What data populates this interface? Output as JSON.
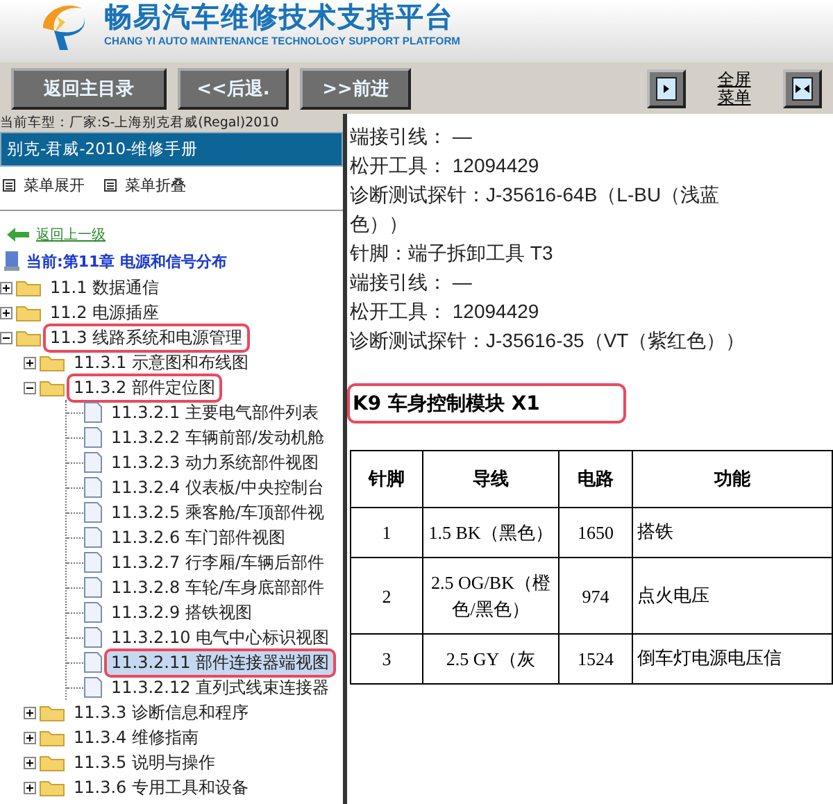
{
  "header": {
    "title": "畅易汽车维修技术支持平台",
    "subtitle": "CHANG YI AUTO MAINTENANCE TECHNOLOGY SUPPORT PLATFORM"
  },
  "toolbar": {
    "buttons": [
      "返回主目录",
      "<<后退.",
      ">>前进"
    ],
    "fullscreen_label": "全屏菜单"
  },
  "sidebar": {
    "vehicle": "当前车型：厂家:S-上海别克君威(Regal)2010",
    "manual_title": "别克-君威-2010-维修手册",
    "menu_actions": [
      "菜单展开",
      "菜单折叠"
    ],
    "back_link": "返回上一级",
    "current": "当前:第11章 电源和信号分布",
    "tree": [
      {
        "label": "11.1 数据通信",
        "kind": "folder",
        "expanded": false,
        "selected": false,
        "highlighted": false
      },
      {
        "label": "11.2 电源插座",
        "kind": "folder",
        "expanded": false,
        "selected": false,
        "highlighted": false
      },
      {
        "label": "11.3 线路系统和电源管理",
        "kind": "folder",
        "expanded": true,
        "selected": false,
        "highlighted": true,
        "children": [
          {
            "label": "11.3.1 示意图和布线图",
            "kind": "folder",
            "expanded": false,
            "selected": false,
            "highlighted": false
          },
          {
            "label": "11.3.2 部件定位图",
            "kind": "folder",
            "expanded": true,
            "selected": false,
            "highlighted": true,
            "children": [
              {
                "label": "11.3.2.1 主要电气部件列表",
                "kind": "page",
                "selected": false,
                "highlighted": false
              },
              {
                "label": "11.3.2.2 车辆前部/发动机舱",
                "kind": "page",
                "selected": false,
                "highlighted": false
              },
              {
                "label": "11.3.2.3 动力系统部件视图",
                "kind": "page",
                "selected": false,
                "highlighted": false
              },
              {
                "label": "11.3.2.4 仪表板/中央控制台",
                "kind": "page",
                "selected": false,
                "highlighted": false
              },
              {
                "label": "11.3.2.5 乘客舱/车顶部件视",
                "kind": "page",
                "selected": false,
                "highlighted": false
              },
              {
                "label": "11.3.2.6 车门部件视图",
                "kind": "page",
                "selected": false,
                "highlighted": false
              },
              {
                "label": "11.3.2.7 行李厢/车辆后部件",
                "kind": "page",
                "selected": false,
                "highlighted": false
              },
              {
                "label": "11.3.2.8 车轮/车身底部部件",
                "kind": "page",
                "selected": false,
                "highlighted": false
              },
              {
                "label": "11.3.2.9 搭铁视图",
                "kind": "page",
                "selected": false,
                "highlighted": false
              },
              {
                "label": "11.3.2.10 电气中心标识视图",
                "kind": "page",
                "selected": false,
                "highlighted": false
              },
              {
                "label": "11.3.2.11 部件连接器端视图",
                "kind": "page",
                "selected": true,
                "highlighted": true
              },
              {
                "label": "11.3.2.12 直列式线束连接器",
                "kind": "page",
                "selected": false,
                "highlighted": false
              }
            ]
          },
          {
            "label": "11.3.3 诊断信息和程序",
            "kind": "folder",
            "expanded": false,
            "selected": false,
            "highlighted": false
          },
          {
            "label": "11.3.4 维修指南",
            "kind": "folder",
            "expanded": false,
            "selected": false,
            "highlighted": false
          },
          {
            "label": "11.3.5 说明与操作",
            "kind": "folder",
            "expanded": false,
            "selected": false,
            "highlighted": false
          },
          {
            "label": "11.3.6 专用工具和设备",
            "kind": "folder",
            "expanded": false,
            "selected": false,
            "highlighted": false
          }
        ]
      }
    ]
  },
  "content": {
    "lines": [
      "端接引线： —",
      "松开工具： 12094429",
      "诊断测试探针：J-35616-64B（L-BU（浅蓝色））",
      "针脚：端子拆卸工具 T3",
      "端接引线： —",
      "松开工具： 12094429",
      "诊断测试探针：J-35616-35（VT（紫红色））"
    ],
    "heading": {
      "text": "K9 车身控制模块 X1",
      "highlighted": true
    },
    "table": {
      "columns": [
        "针脚",
        "导线",
        "电路",
        "功能"
      ],
      "rows": [
        [
          "1",
          "1.5 BK（黑色）",
          "1650",
          "搭铁"
        ],
        [
          "2",
          "2.5 OG/BK（橙色/黑色）",
          "974",
          "点火电压"
        ],
        [
          "3",
          "2.5 GY（灰",
          "1524",
          "倒车灯电源电压信"
        ]
      ]
    }
  }
}
